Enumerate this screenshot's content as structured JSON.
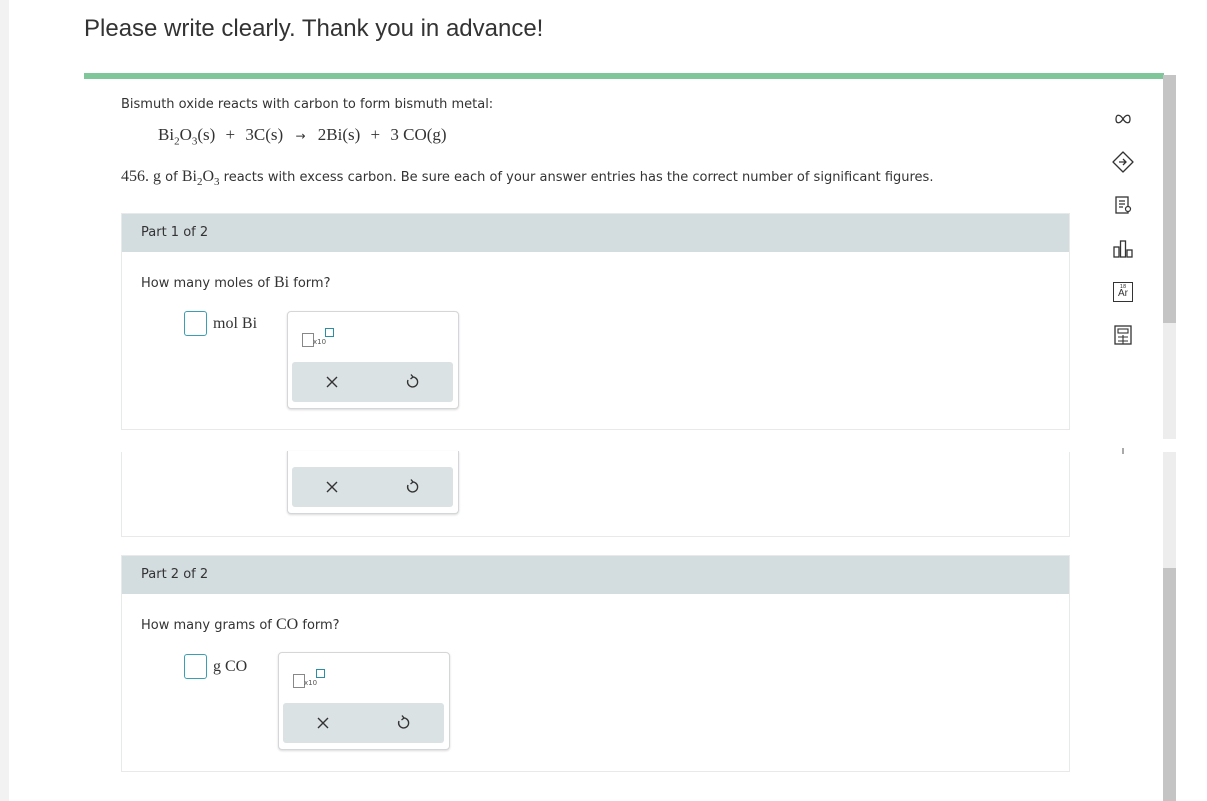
{
  "page": {
    "title": "Please write clearly. Thank you in advance!"
  },
  "problem": {
    "intro": "Bismuth oxide reacts with carbon to form bismuth metal:",
    "equation": {
      "reactant1": "Bi",
      "r1_sub1": "2",
      "r1_mid": "O",
      "r1_sub2": "3",
      "r1_state": "(s)",
      "plus1": "+",
      "reactant2": "3C",
      "r2_state": "(s)",
      "arrow": "→",
      "product1": "2Bi",
      "p1_state": "(s)",
      "plus2": "+",
      "product2": "3 CO",
      "p2_state": "(g)"
    },
    "given_mass": "456. g",
    "given_of": "of",
    "given_compound": "Bi",
    "given_sub1": "2",
    "given_mid": "O",
    "given_sub2": "3",
    "given_rest": "reacts with excess carbon. Be sure each of your answer entries has the correct number of significant figures."
  },
  "part1": {
    "header": "Part 1 of 2",
    "question_pre": "How many moles of",
    "question_species": "Bi",
    "question_post": "form?",
    "unit": "mol Bi",
    "x10": "x10"
  },
  "part1_dup": {
    "x10": "x10"
  },
  "part2": {
    "header": "Part 2 of 2",
    "question_pre": "How many grams of",
    "question_species": "CO",
    "question_post": "form?",
    "unit": "g CO",
    "x10": "x10"
  },
  "sidebar": {
    "icons": [
      "infinity-icon",
      "hint-icon",
      "notes-icon",
      "chart-icon",
      "periodic-table-icon",
      "calculator-icon"
    ],
    "periodic_label": "Ar",
    "periodic_number": "18"
  },
  "colors": {
    "accent_green": "#7fc79a",
    "input_border": "#3a9fb5",
    "panel_header": "#d3dcdf"
  }
}
